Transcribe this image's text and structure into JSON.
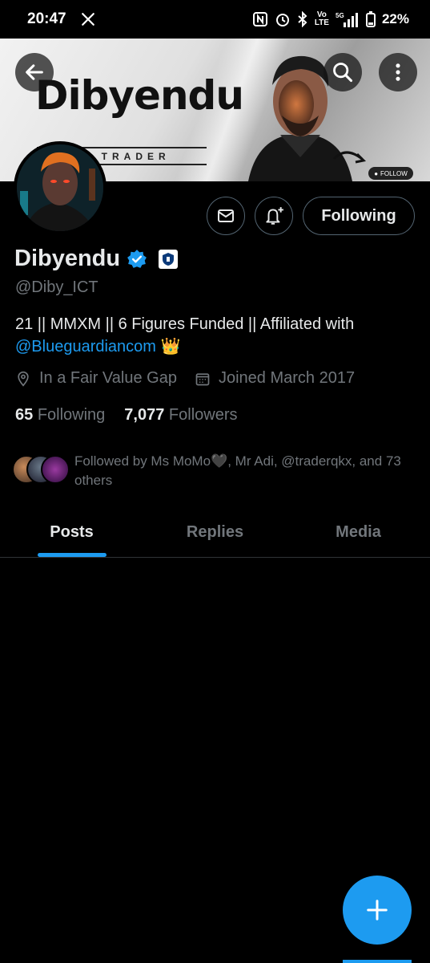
{
  "status_bar": {
    "time": "20:47",
    "x_icon": "x-logo-icon",
    "battery": "22%"
  },
  "banner": {
    "title": "Dibyendu",
    "subtitle": "FOREX TRADER",
    "follow_label": "FOLLOW"
  },
  "profile": {
    "name": "Dibyendu",
    "handle": "@Diby_ICT",
    "bio_text": "21 || MMXM || 6 Figures Funded || Affiliated with",
    "bio_mention": "@Blueguardiancom",
    "bio_emoji": "👑",
    "location": "In a Fair Value Gap",
    "joined": "Joined March 2017",
    "following_count": "65",
    "following_label": "Following",
    "followers_count": "7,077",
    "followers_label": "Followers",
    "followed_by": "Followed by Ms MoMo🖤, Mr Adi, @traderqkx, and 73 others"
  },
  "actions": {
    "following_button": "Following"
  },
  "tabs": [
    {
      "label": "Posts",
      "active": true
    },
    {
      "label": "Replies",
      "active": false
    },
    {
      "label": "Media",
      "active": false
    }
  ],
  "colors": {
    "accent": "#1d9bf0",
    "background": "#000000",
    "secondary_text": "#71767b"
  }
}
